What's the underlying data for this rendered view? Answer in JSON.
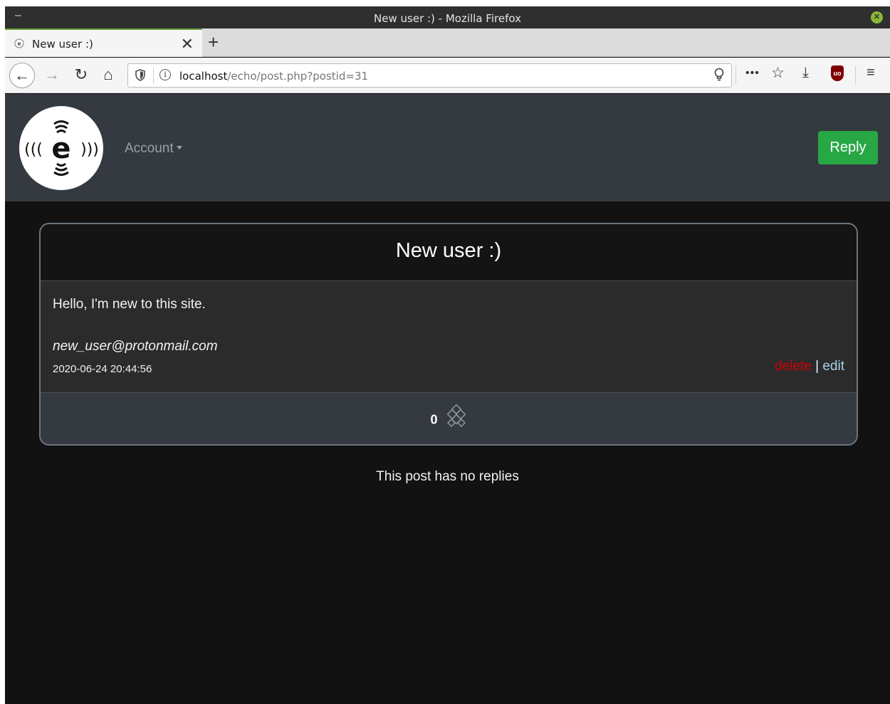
{
  "window": {
    "title": "New user :) - Mozilla Firefox",
    "minimize_glyph": "–",
    "close_glyph": "✕"
  },
  "tabs": [
    {
      "label": "New user :)",
      "close_glyph": "✕",
      "favicon": "echo-favicon-icon"
    }
  ],
  "new_tab_glyph": "+",
  "navigation": {
    "back_glyph": "←",
    "forward_glyph": "→",
    "reload_glyph": "↻",
    "home_glyph": "⌂",
    "url_host": "localhost",
    "url_path": "/echo/post.php?postid=31",
    "page_actions_glyph": "•••",
    "bookmark_glyph": "☆",
    "download_glyph": "⤓",
    "menu_glyph": "≡",
    "ublock_label": "uo"
  },
  "site": {
    "logo_letter": "e",
    "logo_left_waves": "(((",
    "logo_right_waves": ")))",
    "account_label": "Account",
    "reply_label": "Reply"
  },
  "post": {
    "title": "New user :)",
    "body": "Hello, I'm new to this site.",
    "author": "new_user@protonmail.com",
    "timestamp": "2020-06-24 20:44:56",
    "delete_label": "delete",
    "separator": "|",
    "edit_label": "edit",
    "like_count": "0"
  },
  "replies_message": "This post has no replies",
  "colors": {
    "accent_green": "#28a745",
    "delete_red": "#d00000",
    "edit_blue": "#a9d0e8",
    "nav_bg": "#343a40",
    "page_bg": "#121212"
  }
}
